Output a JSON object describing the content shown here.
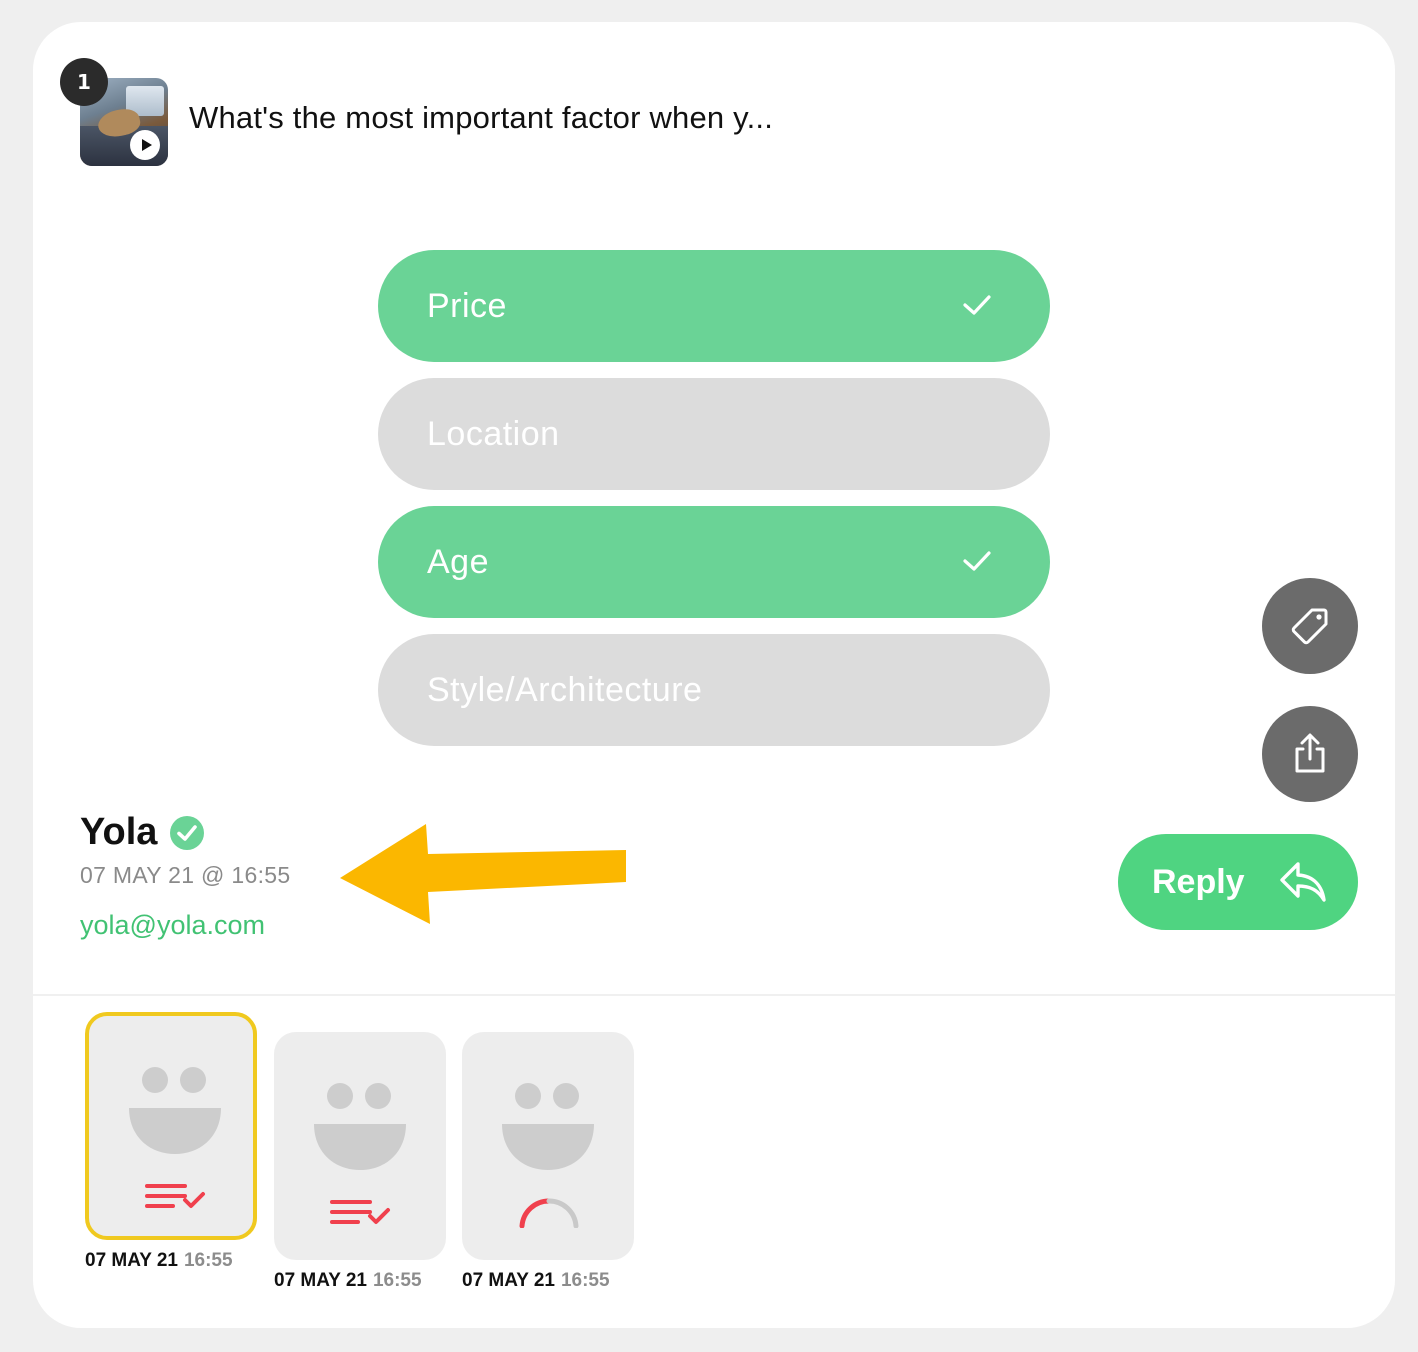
{
  "question": {
    "number": "1",
    "text": "What's the most important factor when y..."
  },
  "options": [
    {
      "label": "Price",
      "selected": true
    },
    {
      "label": "Location",
      "selected": false
    },
    {
      "label": "Age",
      "selected": true
    },
    {
      "label": "Style/Architecture",
      "selected": false
    }
  ],
  "actions": {
    "tag_icon": "tag-icon",
    "share_icon": "share-icon",
    "reply_label": "Reply",
    "reply_icon": "reply-icon"
  },
  "respondent": {
    "name": "Yola",
    "verified": true,
    "datetime": "07 MAY 21 @ 16:55",
    "email": "yola@yola.com"
  },
  "responses": [
    {
      "date": "07 MAY 21",
      "time": "16:55",
      "icon": "checklist-icon",
      "active": true
    },
    {
      "date": "07 MAY 21",
      "time": "16:55",
      "icon": "checklist-icon",
      "active": false
    },
    {
      "date": "07 MAY 21",
      "time": "16:55",
      "icon": "progress-arc-icon",
      "active": false
    }
  ],
  "colors": {
    "selected_option": "#6ad396",
    "unselected_option": "#dcdcdc",
    "reply_button": "#4fd481",
    "email": "#41c273",
    "active_border": "#f0c91f",
    "annotation_arrow": "#fbb700",
    "response_icon": "#f0404d"
  }
}
